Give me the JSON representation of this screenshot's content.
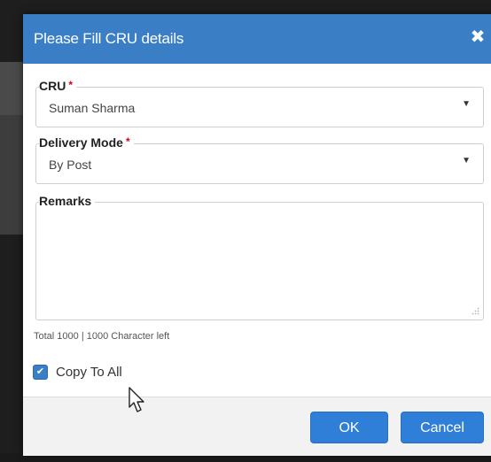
{
  "dialog": {
    "title": "Please Fill CRU details",
    "close_icon": "close-icon",
    "close_glyph": "✖"
  },
  "fields": {
    "cru": {
      "label": "CRU",
      "required_marker": "*",
      "value": "Suman Sharma",
      "caret_glyph": "▼"
    },
    "delivery_mode": {
      "label": "Delivery Mode",
      "required_marker": "*",
      "value": "By Post",
      "caret_glyph": "▼"
    },
    "remarks": {
      "label": "Remarks",
      "value": ""
    }
  },
  "char_counter": "Total 1000 | 1000 Character left",
  "copy_to_all": {
    "label": "Copy To All",
    "checked": true,
    "check_glyph": "✔"
  },
  "buttons": {
    "ok": "OK",
    "cancel": "Cancel"
  },
  "colors": {
    "header_bg": "#3a7fc6",
    "button_bg": "#2f7ed8",
    "required": "#d0021b"
  }
}
